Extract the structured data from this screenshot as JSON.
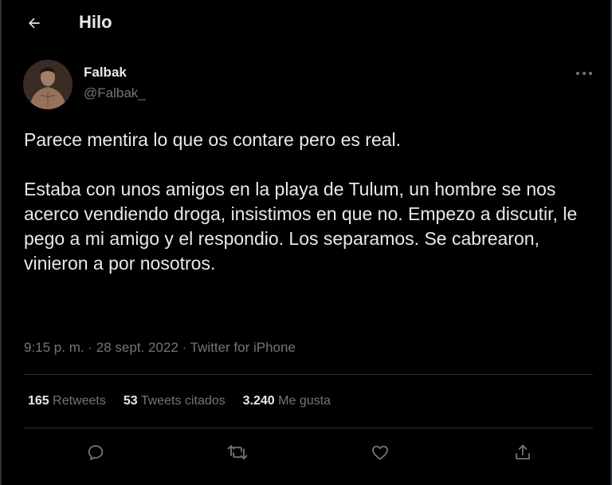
{
  "header": {
    "title": "Hilo",
    "back_icon": "arrow-left-icon"
  },
  "author": {
    "name": "Falbak",
    "handle": "@Falbak_"
  },
  "tweet": {
    "paragraphs": [
      "Parece mentira lo que os contare pero es real.",
      "Estaba con unos amigos en la playa de Tulum, un hombre se nos acerco vendiendo droga, insistimos en que no. Empezo a discutir, le pego a mi amigo y el respondio. Los separamos. Se cabrearon, vinieron a por nosotros."
    ],
    "time": "9:15 p. m.",
    "date": "28 sept. 2022",
    "source": "Twitter for iPhone",
    "separator": "·"
  },
  "stats": {
    "retweets_count": "165",
    "retweets_label": "Retweets",
    "quotes_count": "53",
    "quotes_label": "Tweets citados",
    "likes_count": "3.240",
    "likes_label": "Me gusta"
  },
  "actions": [
    "reply-icon",
    "retweet-icon",
    "like-icon",
    "share-icon"
  ],
  "colors": {
    "background": "#000000",
    "text_primary": "#e7e9ea",
    "text_secondary": "#71767b",
    "divider": "#2f3336"
  }
}
